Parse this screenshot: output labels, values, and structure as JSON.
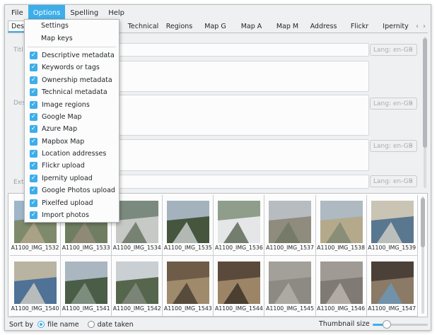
{
  "menubar": {
    "items": [
      "File",
      "Options",
      "Spelling",
      "Help"
    ],
    "active": "Options"
  },
  "tabs": [
    "Desc",
    "Technical",
    "Regions",
    "Map G",
    "Map A",
    "Map M",
    "Address",
    "Flickr",
    "Ipernity"
  ],
  "form": {
    "labels": [
      "Titl",
      "Desc",
      "Exter"
    ],
    "lang_label": "Lang: en-GB"
  },
  "options_menu": {
    "top_items": [
      "Settings",
      "Map keys"
    ],
    "checked_items": [
      "Descriptive metadata",
      "Keywords or tags",
      "Ownership metadata",
      "Technical metadata",
      "Image regions",
      "Google Map",
      "Azure Map",
      "Mapbox Map",
      "Location addresses",
      "Flickr upload",
      "Ipernity upload",
      "Google Photos upload",
      "Pixelfed upload",
      "Import photos"
    ]
  },
  "thumbnails": [
    "A1100_IMG_1532",
    "A1100_IMG_1533",
    "A1100_IMG_1534",
    "A1100_IMG_1535",
    "A1100_IMG_1536",
    "A1100_IMG_1537",
    "A1100_IMG_1538",
    "A1100_IMG_1539",
    "A1100_IMG_1540",
    "A1100_IMG_1541",
    "A1100_IMG_1542",
    "A1100_IMG_1543",
    "A1100_IMG_1544",
    "A1100_IMG_1545",
    "A1100_IMG_1546",
    "A1100_IMG_1547"
  ],
  "bottom": {
    "sort_label": "Sort by",
    "sort_options": [
      "file name",
      "date taken"
    ],
    "sort_selected": "file name",
    "thumbnail_size_label": "Thumbnail size",
    "thumbnail_size_level": 0.25
  },
  "colors": {
    "accent": "#3daee9",
    "window_bg": "#eff0f1",
    "panel_bg": "#fcfcfc"
  }
}
